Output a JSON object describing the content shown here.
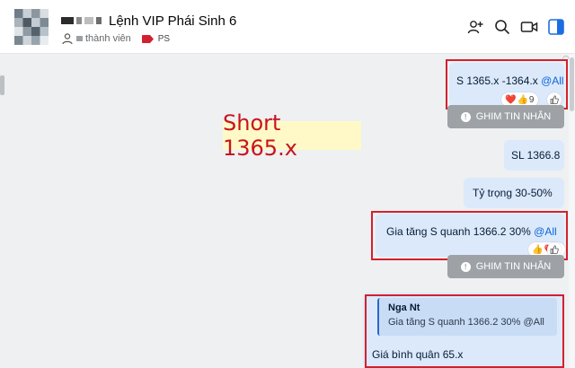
{
  "header": {
    "title": "Lệnh VIP Phái Sinh 6",
    "members_label": "thành viên",
    "tag_label": "PS",
    "tag_color": "#d3202f",
    "buttons": [
      "add-member-icon",
      "search-icon",
      "video-call-icon",
      "sidebar-toggle-icon"
    ]
  },
  "messages": [
    {
      "text": "S 1365.x -1364.x ",
      "mention": "@All",
      "reactions": {
        "icons": [
          "heart",
          "thumbs-up"
        ],
        "count": "9"
      }
    },
    {
      "pin_label": "GHIM TIN NHẮN"
    },
    {
      "text": "SL 1366.8"
    },
    {
      "text": "Tỷ trọng 30-50%"
    },
    {
      "text": "Gia tăng S  quanh 1366.2 30% ",
      "mention": "@All",
      "reactions": {
        "icons": [
          "thumbs-up",
          "heart"
        ],
        "count": "6"
      }
    },
    {
      "pin_label": "GHIM TIN NHẮN"
    },
    {
      "quote_author": "Nga Nt",
      "quote_text": "Gia tăng S quanh 1366.2 30% @All",
      "text": "Giá bình quân 65.x"
    }
  ],
  "overlay_text": "Short 1365.x",
  "colors": {
    "bubble": "#dbe9fb",
    "pin": "#9ea2a6",
    "highlight_frame": "#d3202f",
    "mention": "#0a66d8"
  }
}
